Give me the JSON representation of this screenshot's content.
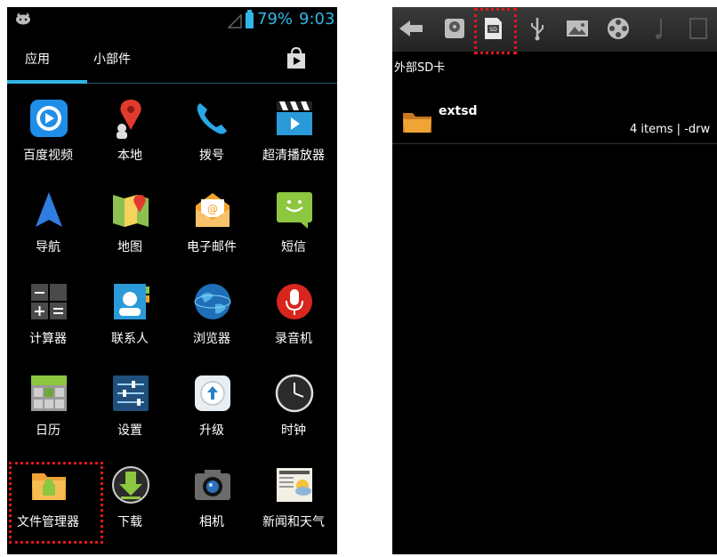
{
  "left_screen": {
    "status": {
      "battery": "79%",
      "time": "9:03"
    },
    "tabs": {
      "apps": "应用",
      "widgets": "小部件"
    },
    "apps": [
      {
        "label": "百度视频",
        "icon": "baidu-video-icon"
      },
      {
        "label": "本地",
        "icon": "map-pin-icon"
      },
      {
        "label": "拨号",
        "icon": "phone-icon"
      },
      {
        "label": "超清播放器",
        "icon": "video-player-icon"
      },
      {
        "label": "导航",
        "icon": "navigation-icon"
      },
      {
        "label": "地图",
        "icon": "maps-icon"
      },
      {
        "label": "电子邮件",
        "icon": "email-icon"
      },
      {
        "label": "短信",
        "icon": "messaging-icon"
      },
      {
        "label": "计算器",
        "icon": "calculator-icon"
      },
      {
        "label": "联系人",
        "icon": "contacts-icon"
      },
      {
        "label": "浏览器",
        "icon": "browser-icon"
      },
      {
        "label": "录音机",
        "icon": "sound-recorder-icon"
      },
      {
        "label": "日历",
        "icon": "calendar-icon"
      },
      {
        "label": "设置",
        "icon": "settings-icon"
      },
      {
        "label": "升级",
        "icon": "update-icon"
      },
      {
        "label": "时钟",
        "icon": "clock-icon"
      },
      {
        "label": "文件管理器",
        "icon": "file-manager-icon"
      },
      {
        "label": "下载",
        "icon": "downloads-icon"
      },
      {
        "label": "相机",
        "icon": "camera-icon"
      },
      {
        "label": "新闻和天气",
        "icon": "news-weather-icon"
      }
    ]
  },
  "right_screen": {
    "toolbar": [
      "back-arrow-icon",
      "internal-storage-icon",
      "sd-card-icon",
      "usb-icon",
      "image-icon",
      "video-icon",
      "music-icon",
      "document-icon"
    ],
    "path": "外部SD卡",
    "items": [
      {
        "name": "extsd",
        "meta": "4 items | -drw"
      }
    ]
  },
  "colors": {
    "accent": "#33b5e5",
    "highlight": "#e0161a",
    "background": "#000000"
  }
}
